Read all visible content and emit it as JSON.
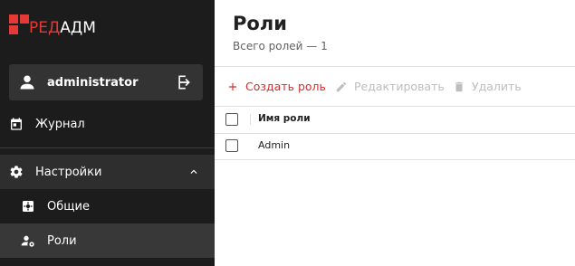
{
  "logo": {
    "red_text": "РЕД",
    "white_text": "АДМ",
    "accent_color": "#e53935"
  },
  "user": {
    "name": "administrator",
    "icon": "person-icon",
    "logout_icon": "logout-icon"
  },
  "nav": {
    "journal": {
      "label": "Журнал",
      "icon": "calendar-icon"
    },
    "settings": {
      "label": "Настройки",
      "icon": "gear-icon",
      "expanded": true
    },
    "general": {
      "label": "Общие",
      "icon": "settings-box-icon"
    },
    "roles": {
      "label": "Роли",
      "icon": "user-gear-icon",
      "active": true
    }
  },
  "page": {
    "title": "Роли",
    "subtitle": "Всего ролей — 1"
  },
  "toolbar": {
    "create_label": "Создать роль",
    "edit_label": "Редактировать",
    "delete_label": "Удалить"
  },
  "table": {
    "columns": [
      "Имя роли"
    ],
    "rows": [
      {
        "name": "Admin"
      }
    ]
  }
}
